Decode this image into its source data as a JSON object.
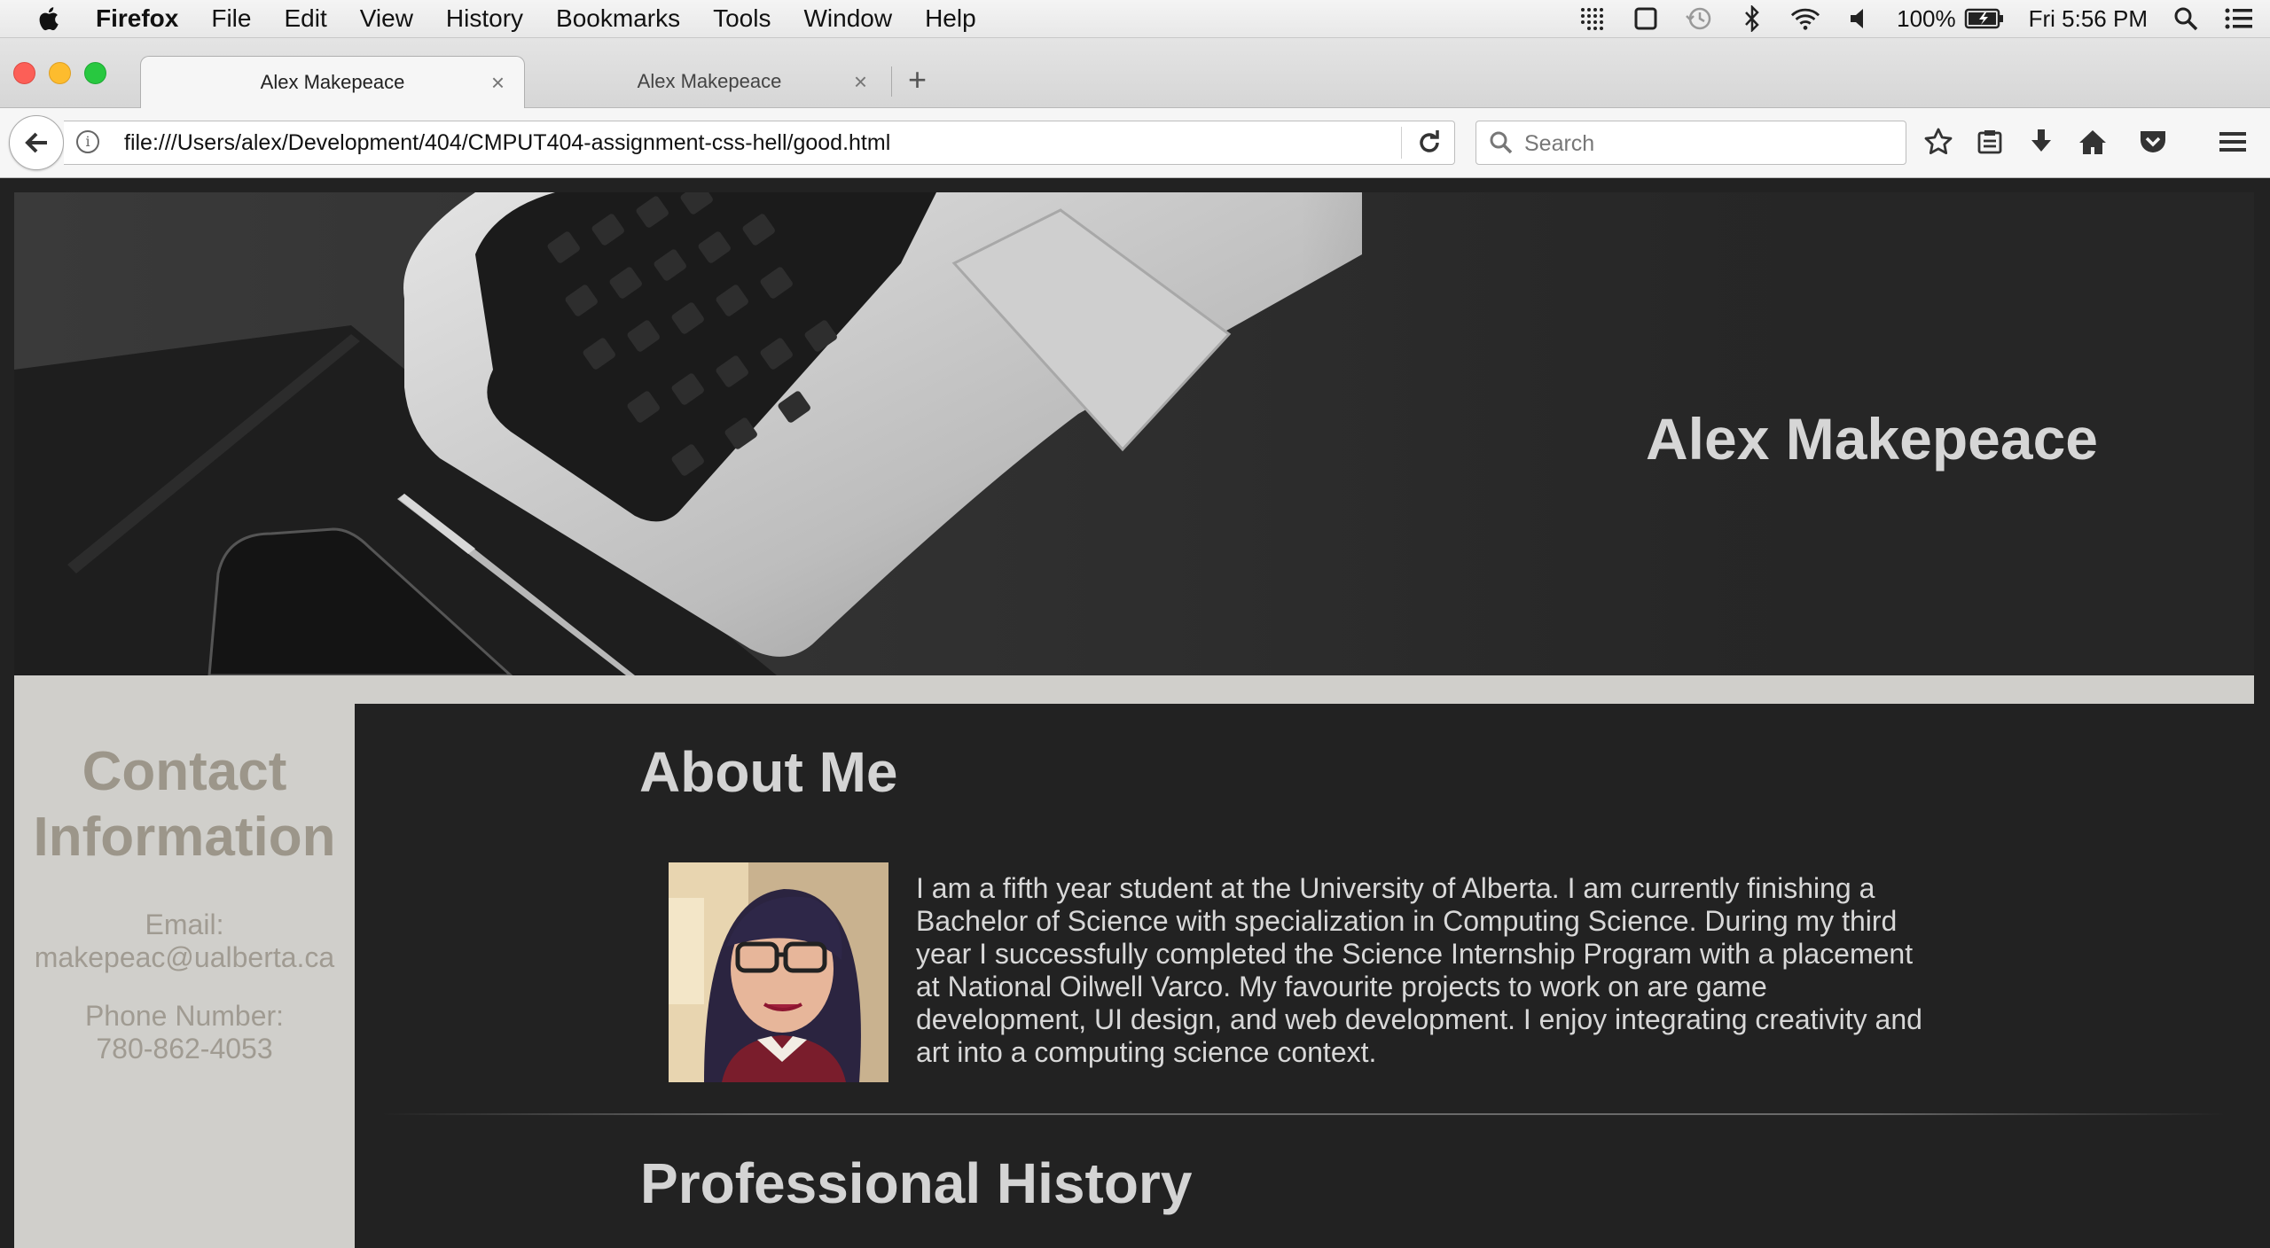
{
  "menubar": {
    "app_name": "Firefox",
    "items": [
      "File",
      "Edit",
      "View",
      "History",
      "Bookmarks",
      "Tools",
      "Window",
      "Help"
    ],
    "battery": "100%",
    "clock": "Fri 5:56 PM"
  },
  "tabs": [
    {
      "title": "Alex Makepeace",
      "active": true
    },
    {
      "title": "Alex Makepeace",
      "active": false
    }
  ],
  "navbar": {
    "url": "file:///Users/alex/Development/404/CMPUT404-assignment-css-hell/good.html",
    "search_placeholder": "Search"
  },
  "page": {
    "hero_title": "Alex Makepeace",
    "sidebar": {
      "heading": "Contact Information",
      "email_label": "Email:",
      "email": "makepeac@ualberta.ca",
      "phone_label": "Phone Number:",
      "phone": "780-862-4053"
    },
    "about": {
      "heading": "About Me",
      "text": "I am a fifth year student at the University of Alberta. I am currently finishing a Bachelor of Science with specialization in Computing Science. During my third year I successfully completed the Science Internship Program with a placement at National Oilwell Varco. My favourite projects to work on are game development, UI design, and web development. I enjoy integrating creativity and art into a computing science context."
    },
    "history": {
      "heading": "Professional History"
    }
  },
  "colors": {
    "page_bg": "#222222",
    "sidebar_bg": "#d0cfcb",
    "heading_text": "#d4d4d4",
    "sidebar_text": "#9c968a"
  }
}
